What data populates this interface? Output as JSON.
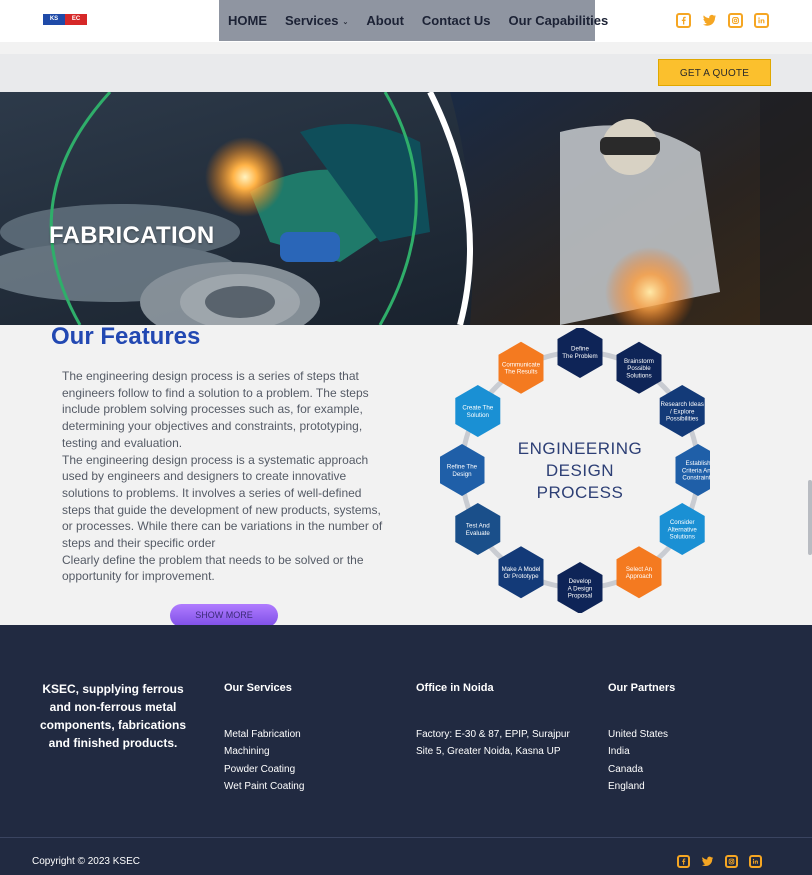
{
  "brand": {
    "logo_left": "KS",
    "logo_right": "EC"
  },
  "nav": {
    "items": [
      {
        "label": "HOME"
      },
      {
        "label": "Services"
      },
      {
        "label": "About"
      },
      {
        "label": "Contact Us"
      },
      {
        "label": "Our Capabilities"
      }
    ],
    "services_caret": "⌄"
  },
  "cta": {
    "quote_label": "GET A QUOTE"
  },
  "hero": {
    "title": "FABRICATION"
  },
  "features": {
    "title": "Our Features",
    "paragraphs": [
      "The engineering design process is a series of steps that engineers follow to find a solution to a problem. The steps include problem solving processes such as, for example, determining your objectives and constraints, prototyping, testing and evaluation.",
      "The engineering design process is a systematic approach used by engineers and designers to create innovative solutions to problems. It involves a series of well-defined steps that guide the development of new products, systems, or processes. While there can be variations in the number of steps and their specific order",
      "Clearly define the problem that needs to be solved or the opportunity for improvement."
    ],
    "show_more_label": "SHOW MORE"
  },
  "diagram": {
    "center_lines": [
      "ENGINEERING",
      "DESIGN",
      "PROCESS"
    ],
    "steps": [
      {
        "label": [
          "Define",
          "The Problem"
        ],
        "color": "#0e2457"
      },
      {
        "label": [
          "Brainstorm",
          "Possible",
          "Solutions"
        ],
        "color": "#0e2457"
      },
      {
        "label": [
          "Research Ideas",
          "/ Explore",
          "Possibilities"
        ],
        "color": "#133a78"
      },
      {
        "label": [
          "Establish",
          "Criteria And",
          "Constraints"
        ],
        "color": "#1f5fa8"
      },
      {
        "label": [
          "Consider",
          "Alternative",
          "Solutions"
        ],
        "color": "#1a90d4"
      },
      {
        "label": [
          "Select An",
          "Approach"
        ],
        "color": "#f47a20"
      },
      {
        "label": [
          "Develop",
          "A Design",
          "Proposal"
        ],
        "color": "#0e2457"
      },
      {
        "label": [
          "Make A Model",
          "Or Prototype"
        ],
        "color": "#133a78"
      },
      {
        "label": [
          "Test And",
          "Evaluate"
        ],
        "color": "#1a4f8a"
      },
      {
        "label": [
          "Refine The",
          "Design"
        ],
        "color": "#1f5fa8"
      },
      {
        "label": [
          "Create The",
          "Solution"
        ],
        "color": "#1a90d4"
      },
      {
        "label": [
          "Communicate",
          "The Results"
        ],
        "color": "#f47a20"
      }
    ]
  },
  "footer": {
    "tagline": "KSEC, supplying ferrous and non-ferrous metal components, fabrications and finished products.",
    "services_title": "Our Services",
    "services": [
      "Metal Fabrication",
      "Machining",
      "Powder Coating",
      "Wet Paint Coating"
    ],
    "office_title": "Office in Noida",
    "office_address": "Factory: E-30 & 87, EPIP, Surajpur Site 5, Greater Noida, Kasna UP",
    "partners_title": "Our Partners",
    "partners": [
      "United States",
      "India",
      "Canada",
      "England"
    ],
    "copyright": "Copyright © 2023 KSEC"
  },
  "social": {
    "icons": [
      "facebook-icon",
      "twitter-icon",
      "instagram-icon",
      "linkedin-icon"
    ],
    "accent": "#f5a623"
  },
  "colors": {
    "nav_bg": "#8f95a1",
    "quote_bg": "#fbc02d",
    "features_title": "#2248b2",
    "footer_bg": "#212a41",
    "orange": "#f47a20",
    "navy": "#0e2457",
    "blue": "#1a90d4"
  }
}
